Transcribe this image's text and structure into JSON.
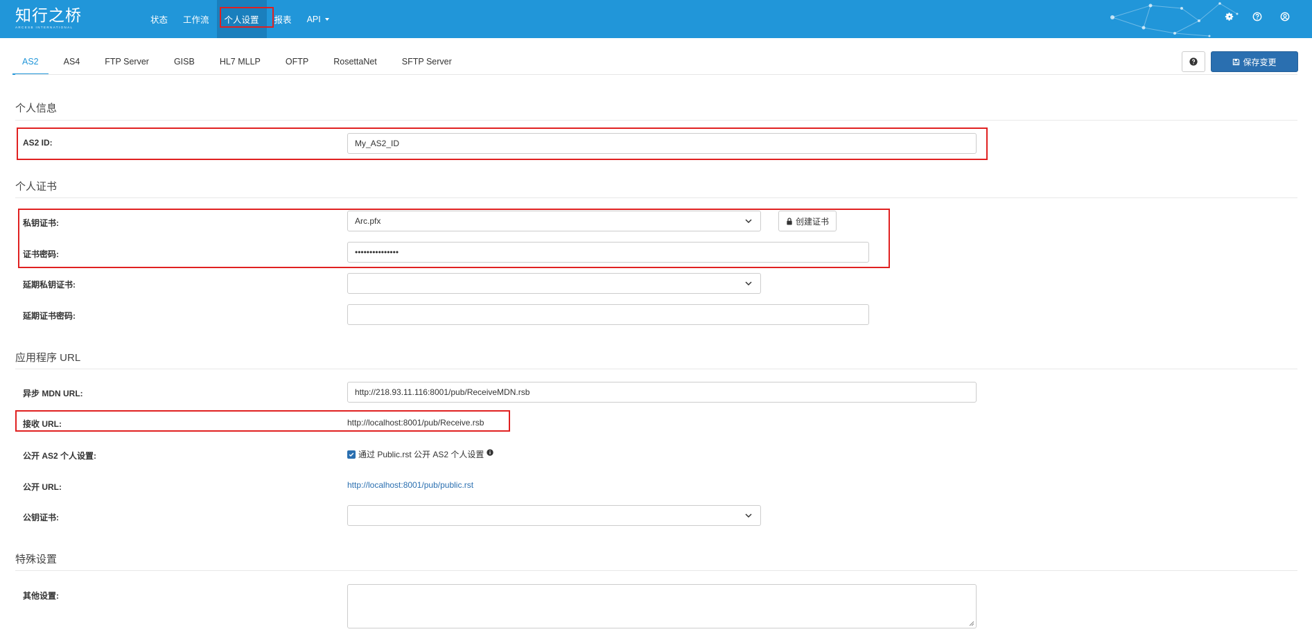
{
  "brand": {
    "name": "知行之桥",
    "subtitle": "ARCESB INTERNATIONAL"
  },
  "nav": {
    "items": [
      {
        "label": "状态"
      },
      {
        "label": "工作流"
      },
      {
        "label": "个人设置"
      },
      {
        "label": "报表"
      },
      {
        "label": "API"
      }
    ]
  },
  "top_icons": [
    "gear-icon",
    "help-circle-icon",
    "user-circle-icon"
  ],
  "tabs": [
    "AS2",
    "AS4",
    "FTP Server",
    "GISB",
    "HL7 MLLP",
    "OFTP",
    "RosettaNet",
    "SFTP Server"
  ],
  "toolbar": {
    "save_label": "保存变更"
  },
  "sections": {
    "personal_info": "个人信息",
    "personal_cert": "个人证书",
    "app_url": "应用程序 URL",
    "special": "特殊设置"
  },
  "fields": {
    "as2_id": {
      "label": "AS2 ID:",
      "value": "My_AS2_ID"
    },
    "private_cert": {
      "label": "私钥证书:",
      "value": "Arc.pfx"
    },
    "create_cert_label": "创建证书",
    "cert_password": {
      "label": "证书密码:",
      "value": "•••••••••••••••"
    },
    "ext_private_cert": {
      "label": "延期私钥证书:",
      "value": ""
    },
    "ext_cert_password": {
      "label": "延期证书密码:",
      "value": ""
    },
    "async_mdn_url": {
      "label": "异步 MDN URL:",
      "value": "http://218.93.11.116:8001/pub/ReceiveMDN.rsb"
    },
    "receive_url": {
      "label": "接收 URL:",
      "value": "http://localhost:8001/pub/Receive.rsb"
    },
    "public_as2": {
      "label": "公开 AS2 个人设置:",
      "checkbox_label": "通过 Public.rst 公开 AS2 个人设置",
      "checked": true
    },
    "public_url": {
      "label": "公开 URL:",
      "value": "http://localhost:8001/pub/public.rst"
    },
    "public_cert": {
      "label": "公钥证书:",
      "value": ""
    },
    "other_settings": {
      "label": "其他设置:",
      "value": ""
    }
  },
  "colors": {
    "header": "#2196d9",
    "accent": "#2a6fb0",
    "highlight": "#e02020"
  }
}
